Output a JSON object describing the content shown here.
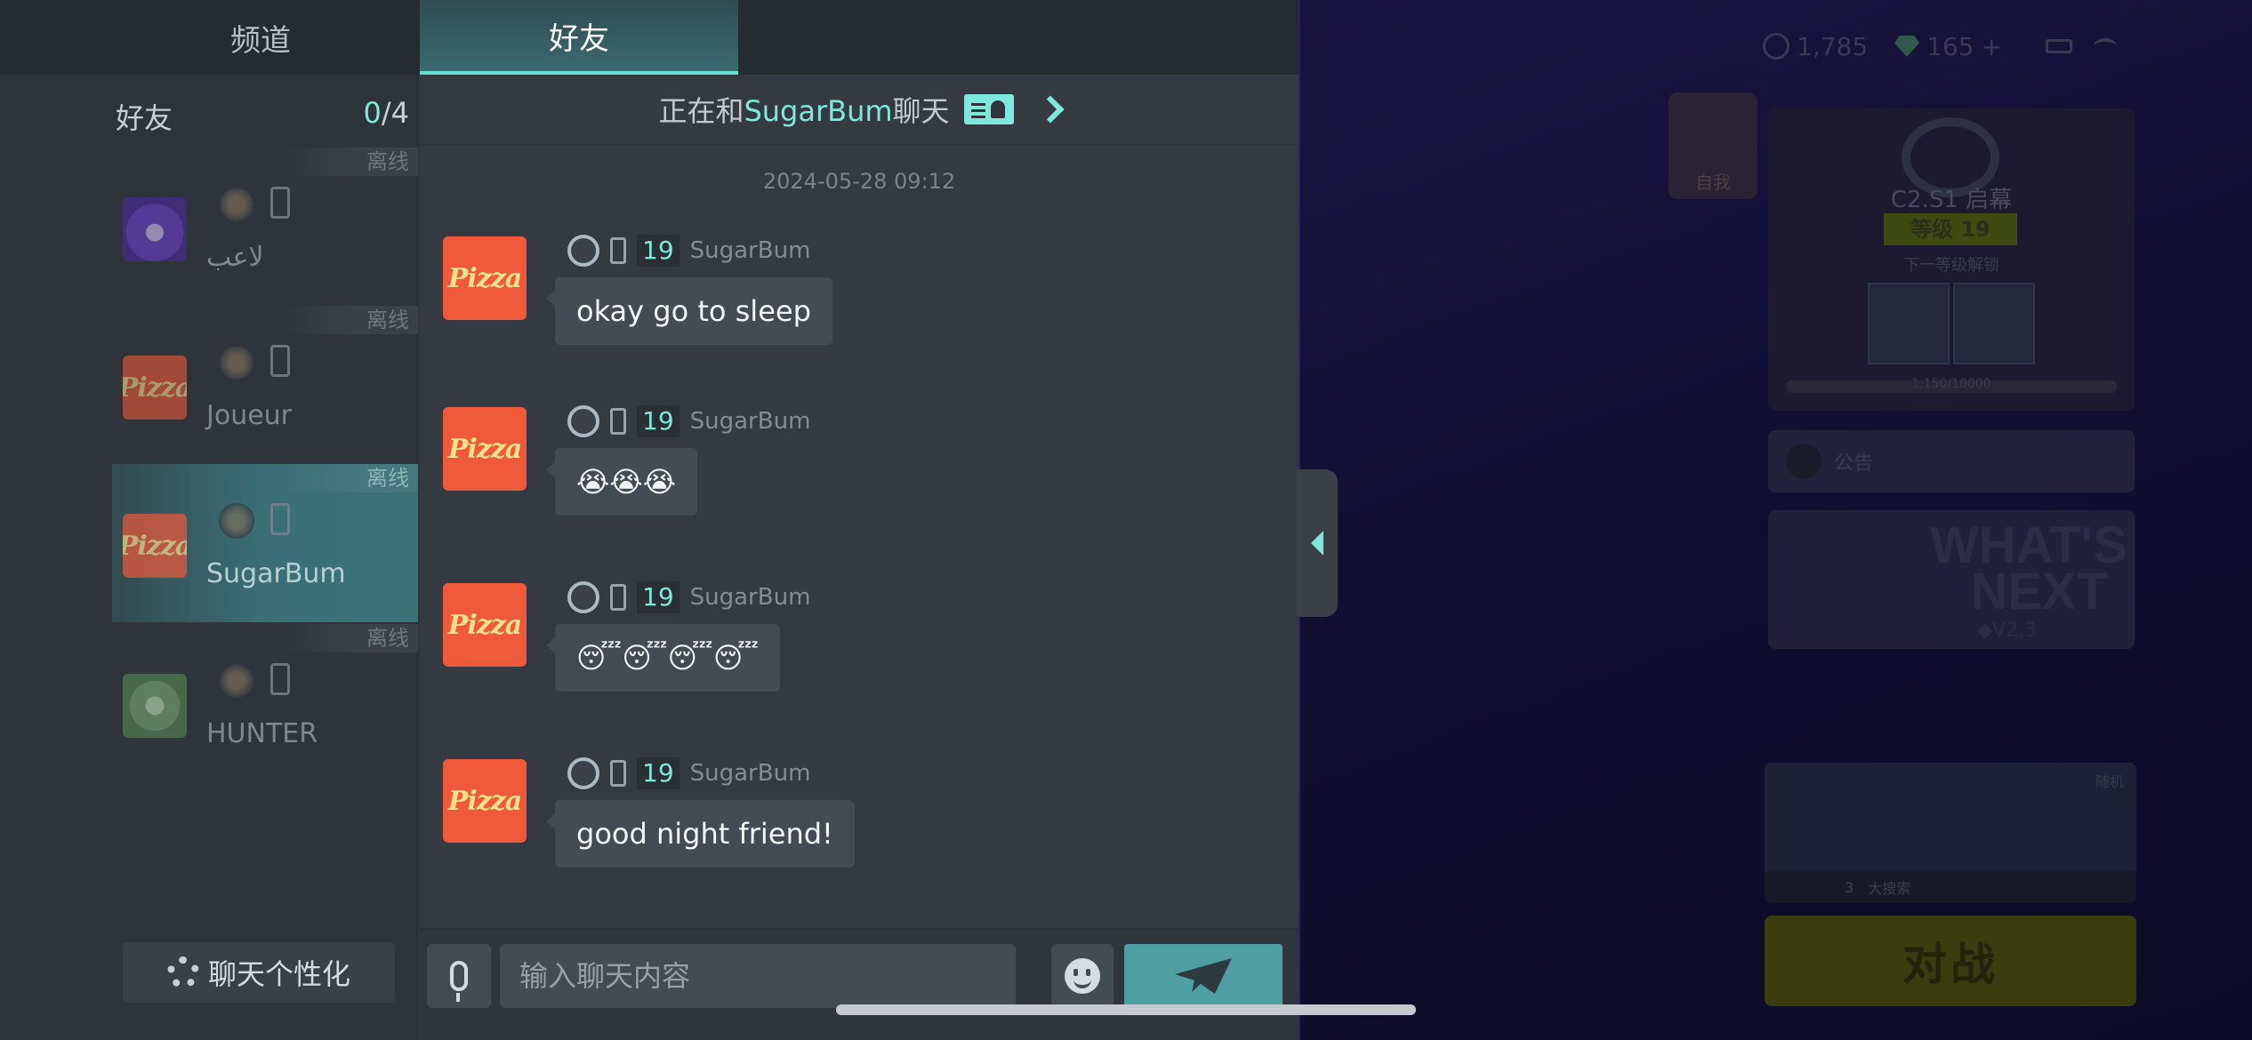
{
  "tabs": {
    "channel": "频道",
    "friends": "好友"
  },
  "friends": {
    "header_label": "好友",
    "count_current": "0",
    "count_total": "/4",
    "items": [
      {
        "name": "لاعب",
        "status": "离线",
        "avatar": "monster-avatar"
      },
      {
        "name": "Joueur",
        "status": "离线",
        "avatar": "pizza-avatar"
      },
      {
        "name": "SugarBum",
        "status": "离线",
        "avatar": "pizza-avatar",
        "selected": true
      },
      {
        "name": "HUNTER",
        "status": "离线",
        "avatar": "hunter-avatar"
      }
    ],
    "settings_label": "聊天个性化"
  },
  "chat": {
    "header_prefix": "正在和",
    "partner": "SugarBum",
    "header_suffix": "聊天",
    "date": "2024-05-28 09:12",
    "avatar_text": "Pizza",
    "messages": [
      {
        "level": "19",
        "sender": "SugarBum",
        "text": "okay go to sleep"
      },
      {
        "level": "19",
        "sender": "SugarBum",
        "text": "😭😭😭"
      },
      {
        "level": "19",
        "sender": "SugarBum",
        "text": "😴😴😴😴"
      },
      {
        "level": "19",
        "sender": "SugarBum",
        "text": "good night friend!"
      }
    ],
    "input_placeholder": "输入聊天内容"
  },
  "background": {
    "coins": "1,785",
    "gems": "165",
    "plus": "+",
    "self_label": "自我",
    "season_title": "C2.S1 启幕",
    "season_level": "等级 19",
    "season_next": "下一等级解锁",
    "season_xp": "1,150/10000",
    "notice_label": "公告",
    "news_title": "WHAT'S NEXT",
    "news_version": "◆V2.3",
    "mode_tag": "随机",
    "mode_players": "3",
    "mode_name": "大搜索",
    "battle_label": "对战"
  },
  "colors": {
    "accent": "#7ee8dc",
    "panel": "#2f343c",
    "bubble": "#454b55",
    "send": "#4e9ea2"
  }
}
